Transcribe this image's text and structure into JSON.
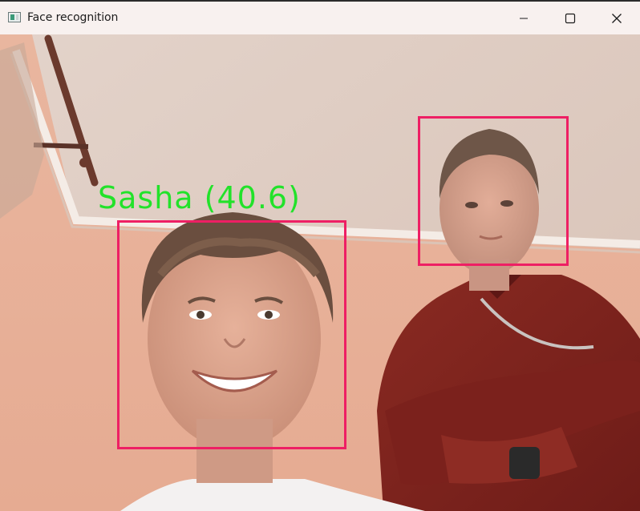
{
  "window": {
    "title": "Face recognition",
    "icon": "app-window-icon",
    "controls": {
      "minimize_icon": "minimize-icon",
      "maximize_icon": "maximize-icon",
      "close_icon": "close-icon"
    }
  },
  "detections": [
    {
      "label": "Sasha (40.6)",
      "box_color": "#ee1f64",
      "label_color": "#22e22a"
    },
    {
      "label": "",
      "box_color": "#ee1f64"
    }
  ],
  "colors": {
    "box": "#ee1f64",
    "label": "#22e22a"
  }
}
